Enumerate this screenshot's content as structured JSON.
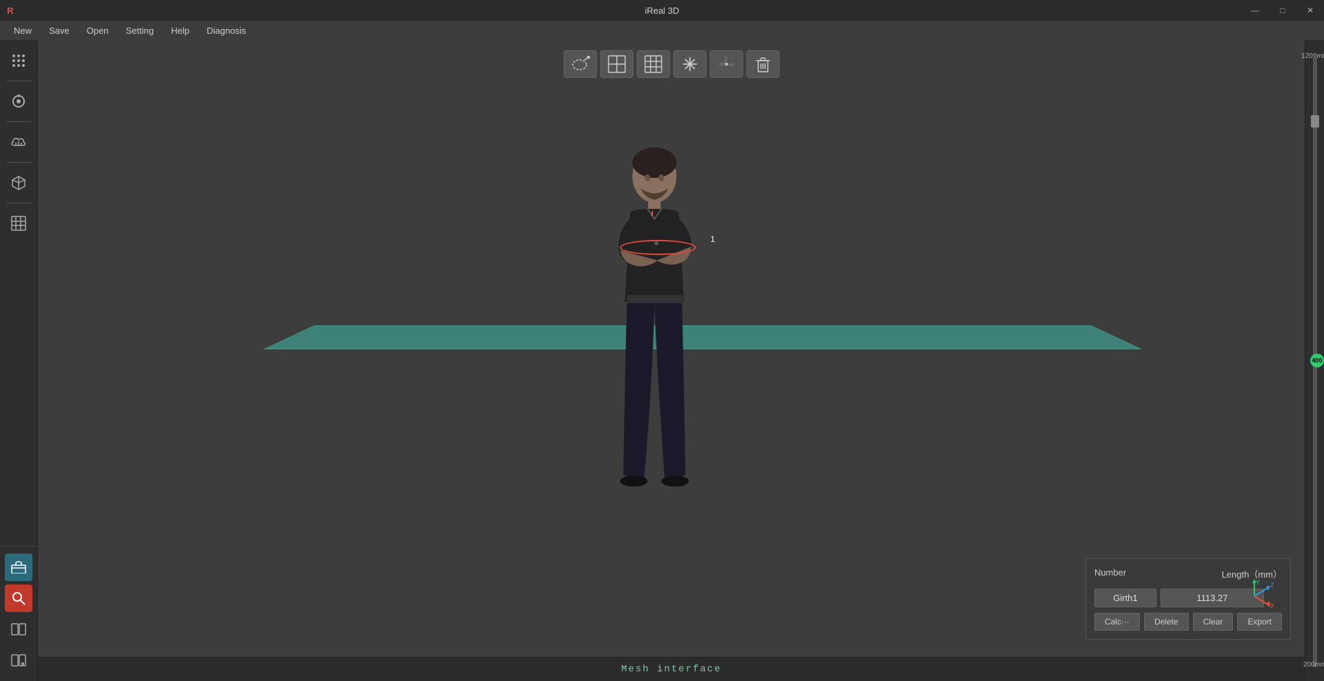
{
  "app": {
    "title": "iReal 3D",
    "logo": "R"
  },
  "titlebar": {
    "controls": {
      "minimize": "—",
      "maximize": "□",
      "close": "✕"
    }
  },
  "menubar": {
    "items": [
      "New",
      "Save",
      "Open",
      "Setting",
      "Help",
      "Diagnosis"
    ]
  },
  "left_sidebar": {
    "icons": [
      {
        "name": "grid-dots-icon",
        "symbol": "⠿",
        "active": false
      },
      {
        "name": "refresh-icon",
        "symbol": "◎",
        "active": false
      },
      {
        "name": "cloud-icon",
        "symbol": "☁",
        "active": false
      },
      {
        "name": "cube-icon",
        "symbol": "⬡",
        "active": false
      },
      {
        "name": "grid-icon",
        "symbol": "▦",
        "active": false
      }
    ],
    "bottom_icons": [
      {
        "name": "toolbox-icon",
        "symbol": "🧰",
        "active": true,
        "color": "teal"
      },
      {
        "name": "search-icon",
        "symbol": "🔍",
        "active": true,
        "color": "red"
      },
      {
        "name": "split-view-icon",
        "symbol": "⊞",
        "active": false
      },
      {
        "name": "split-view-dot-icon",
        "symbol": "⊟",
        "active": false
      }
    ]
  },
  "viewport_toolbar": {
    "buttons": [
      {
        "name": "lasso-icon",
        "symbol": "⌾",
        "label": "Lasso",
        "active": false
      },
      {
        "name": "grid4-icon",
        "symbol": "⊞",
        "label": "Grid4",
        "active": false
      },
      {
        "name": "grid9-icon",
        "symbol": "⊞",
        "label": "Grid9",
        "active": false
      },
      {
        "name": "asterisk-icon",
        "symbol": "✳",
        "label": "Feature",
        "active": false
      },
      {
        "name": "fan-icon",
        "symbol": "✈",
        "label": "Fan",
        "active": false
      },
      {
        "name": "trash-icon",
        "symbol": "🗑",
        "label": "Delete",
        "active": false
      }
    ]
  },
  "scene": {
    "girth_label": "1",
    "plane_visible": true
  },
  "measurement_panel": {
    "col_number": "Number",
    "col_length": "Length（mm）",
    "rows": [
      {
        "number": "Girth1",
        "length": "1113.27"
      }
    ],
    "buttons": {
      "calc": "Calc···",
      "delete": "Delete",
      "clear": "Clear",
      "export": "Export"
    }
  },
  "ruler": {
    "top_label": "1200mm",
    "bottom_label": "200mm",
    "green_dot_value": "400"
  },
  "statusbar": {
    "text": "Mesh interface"
  },
  "axis": {
    "y_color": "#2ecc71",
    "z_color": "#3498db",
    "x_color": "#e74c3c"
  }
}
